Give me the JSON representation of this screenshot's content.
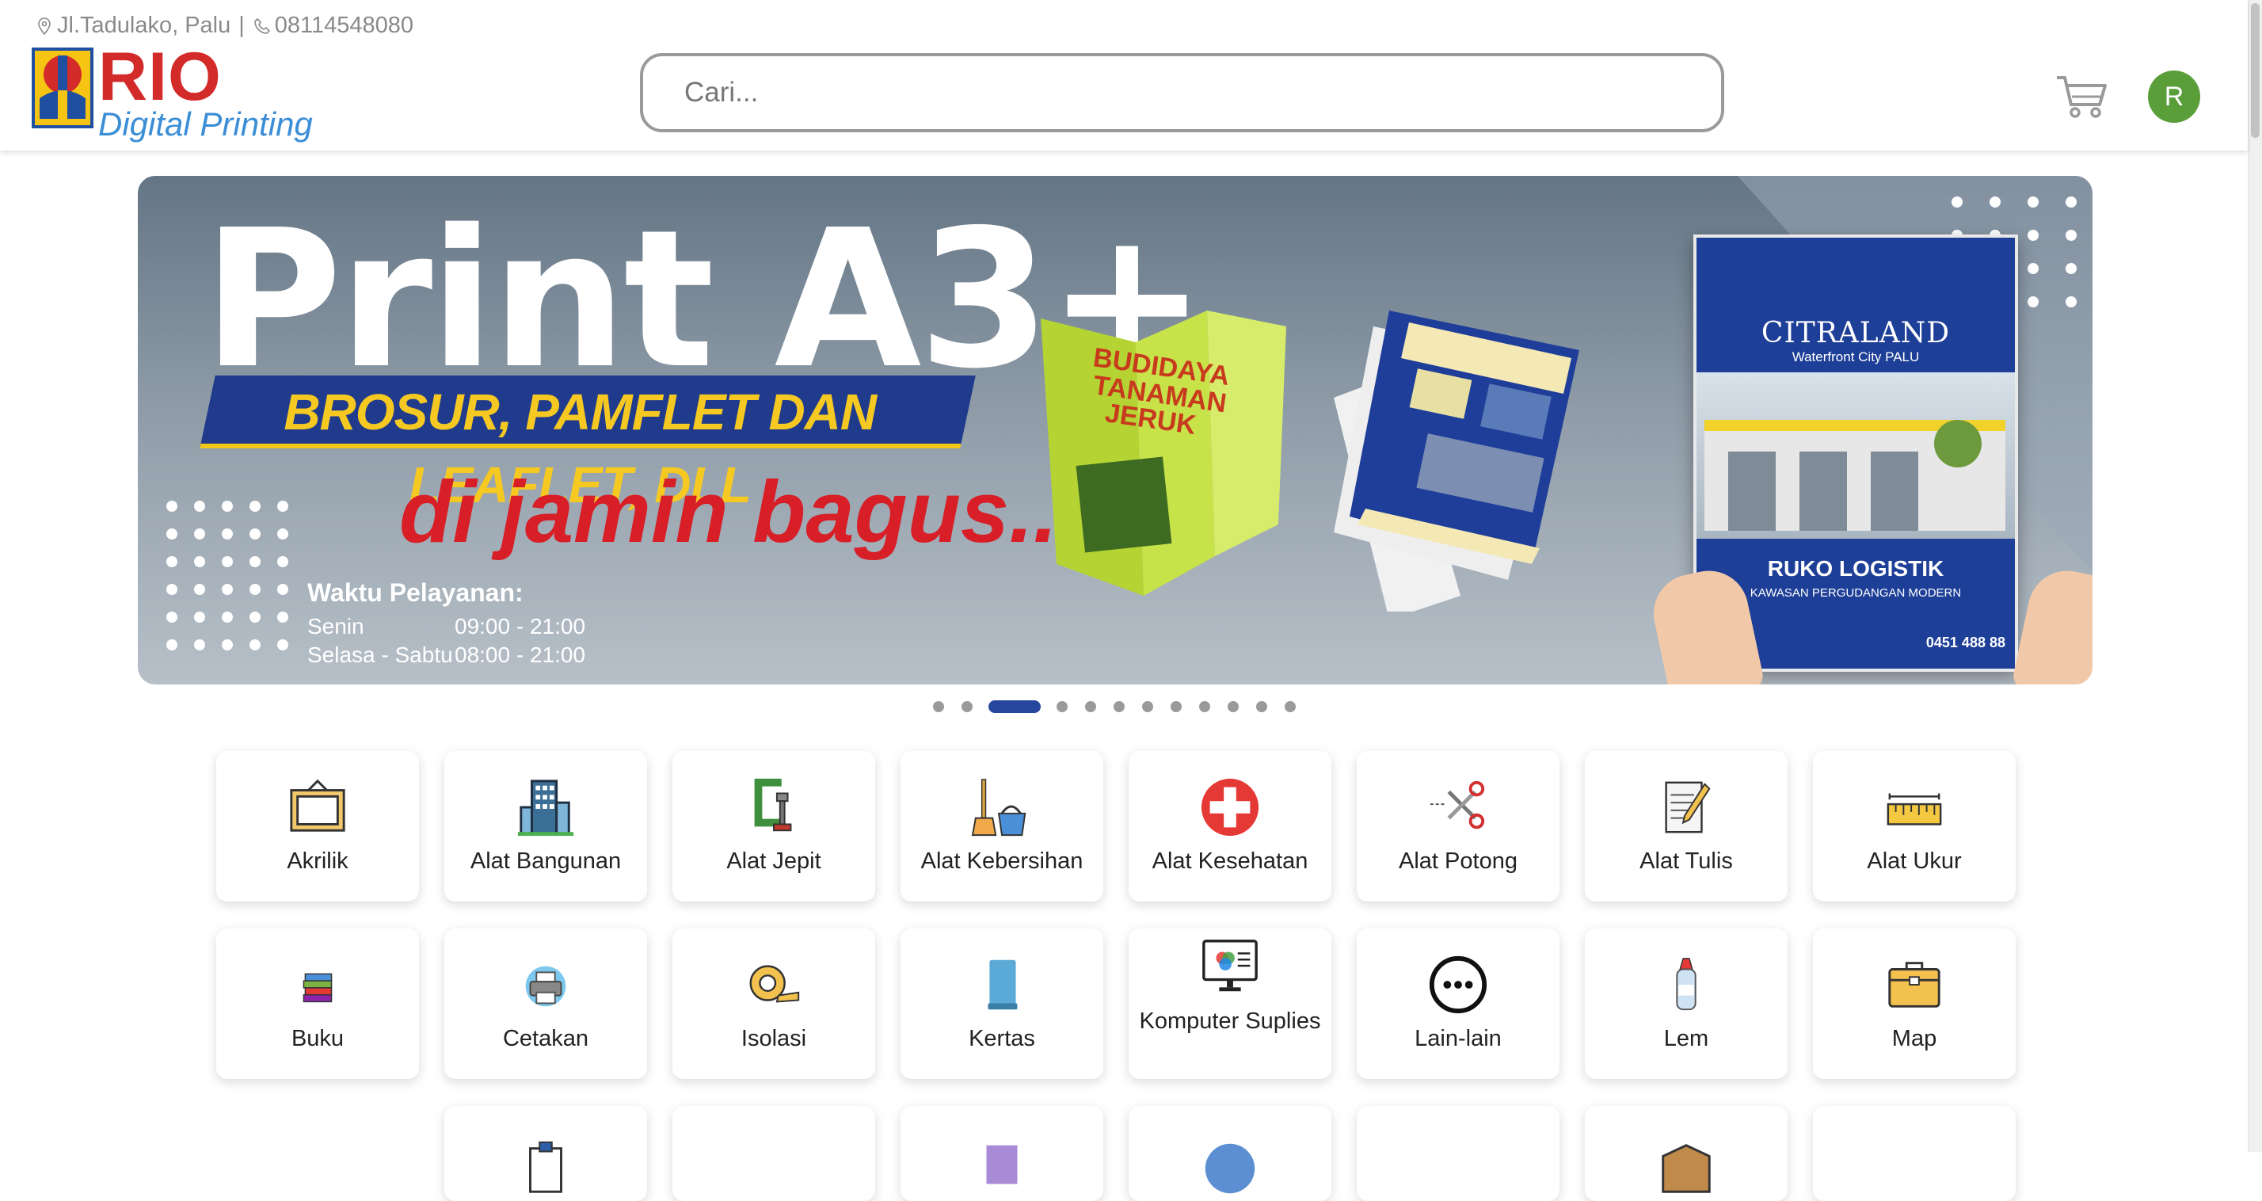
{
  "header": {
    "address": "Jl.Tadulako, Palu",
    "phone": "08114548080",
    "logo_main": "RIO",
    "logo_sub": "Digital Printing",
    "search_placeholder": "Cari...",
    "cart_icon": "cart-icon",
    "avatar_initial": "R"
  },
  "banner": {
    "title": "Print A3+",
    "strip": "BROSUR, PAMFLET DAN LEAFLET, DLL",
    "tagline": "di jamin bagus....",
    "hours_title": "Waktu Pelayanan:",
    "hours": [
      {
        "day": "Senin",
        "time": "09:00 - 21:00"
      },
      {
        "day": "Selasa - Sabtu",
        "time": "08:00 - 21:00"
      }
    ],
    "brochure_title": "BUDIDAYA TANAMAN JERUK",
    "poster_brand": "CITRALAND",
    "poster_sub": "Waterfront City PALU",
    "poster_title": "RUKO LOGISTIK",
    "poster_sub2": "KAWASAN PERGUDANGAN MODERN",
    "poster_phone": "0451 488 88"
  },
  "carousel": {
    "count": 13,
    "active": 2
  },
  "categories": [
    {
      "label": "Akrilik",
      "icon": "frame-icon"
    },
    {
      "label": "Alat Bangunan",
      "icon": "building-icon"
    },
    {
      "label": "Alat Jepit",
      "icon": "clamp-icon"
    },
    {
      "label": "Alat Kebersihan",
      "icon": "cleaning-icon"
    },
    {
      "label": "Alat Kesehatan",
      "icon": "medical-cross-icon"
    },
    {
      "label": "Alat Potong",
      "icon": "scissors-icon"
    },
    {
      "label": "Alat Tulis",
      "icon": "notepad-pencil-icon"
    },
    {
      "label": "Alat Ukur",
      "icon": "ruler-icon"
    },
    {
      "label": "Buku",
      "icon": "books-icon"
    },
    {
      "label": "Cetakan",
      "icon": "printer-icon"
    },
    {
      "label": "Isolasi",
      "icon": "tape-icon"
    },
    {
      "label": "Kertas",
      "icon": "paper-icon"
    },
    {
      "label": "Komputer Suplies",
      "icon": "computer-icon"
    },
    {
      "label": "Lain-lain",
      "icon": "more-icon"
    },
    {
      "label": "Lem",
      "icon": "glue-icon"
    },
    {
      "label": "Map",
      "icon": "folder-case-icon"
    }
  ],
  "colors": {
    "accent": "#27479e",
    "logo_red": "#d32a2a",
    "logo_blue": "#3b8ed6",
    "avatar": "#5a9e3a"
  }
}
